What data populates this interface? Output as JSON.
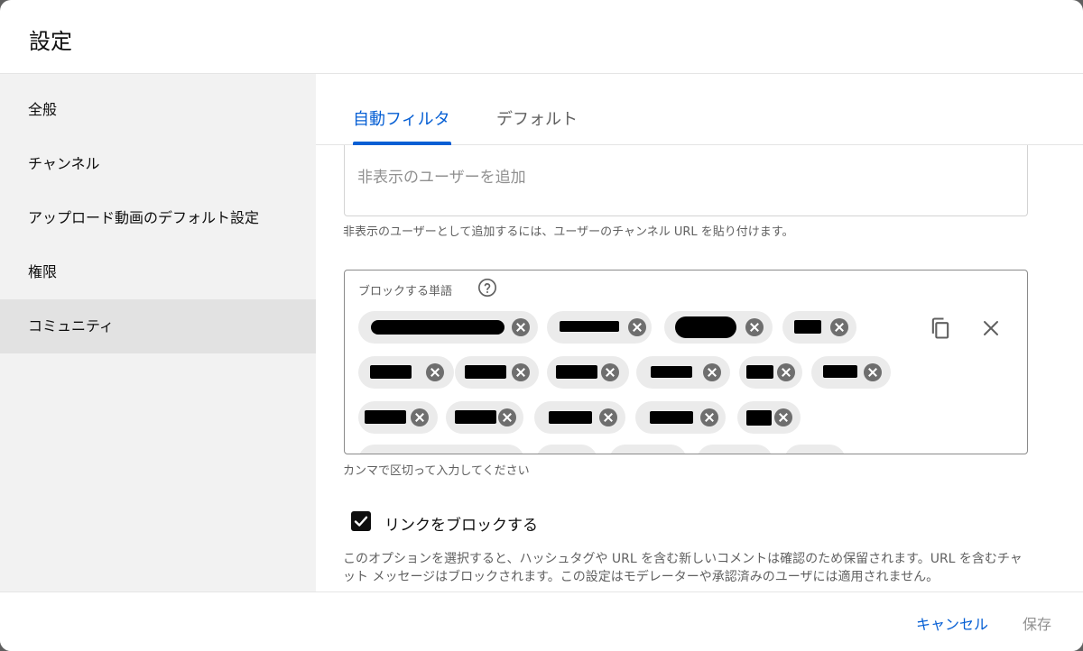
{
  "dialog": {
    "title": "設定"
  },
  "sidebar": {
    "items": [
      {
        "label": "全般"
      },
      {
        "label": "チャンネル"
      },
      {
        "label": "アップロード動画のデフォルト設定"
      },
      {
        "label": "権限"
      },
      {
        "label": "コミュニティ",
        "active": true
      }
    ]
  },
  "tabs": [
    {
      "label": "自動フィルタ",
      "active": true
    },
    {
      "label": "デフォルト"
    }
  ],
  "hidden_users": {
    "placeholder": "非表示のユーザーを追加",
    "value": "",
    "helper": "非表示のユーザーとして追加するには、ユーザーのチャンネル URL を貼り付けます。"
  },
  "blocked_words": {
    "label": "ブロックする単語",
    "helper": "カンマで区切って入力してください",
    "icons": {
      "help": "help-circle-icon",
      "copy": "copy-icon",
      "clear": "close-icon"
    }
  },
  "block_links": {
    "checked": true,
    "label": "リンクをブロックする",
    "description": "このオプションを選択すると、ハッシュタグや URL を含む新しいコメントは確認のため保留されます。URL を含むチャット メッセージはブロックされます。この設定はモデレーターや承認済みのユーザには適用されません。"
  },
  "footer": {
    "cancel_label": "キャンセル",
    "save_label": "保存"
  },
  "colors": {
    "accent": "#065fd4",
    "sidebar_bg": "#f2f2f2",
    "active_bg": "#e2e2e2",
    "chip_bg": "#ebebeb"
  }
}
